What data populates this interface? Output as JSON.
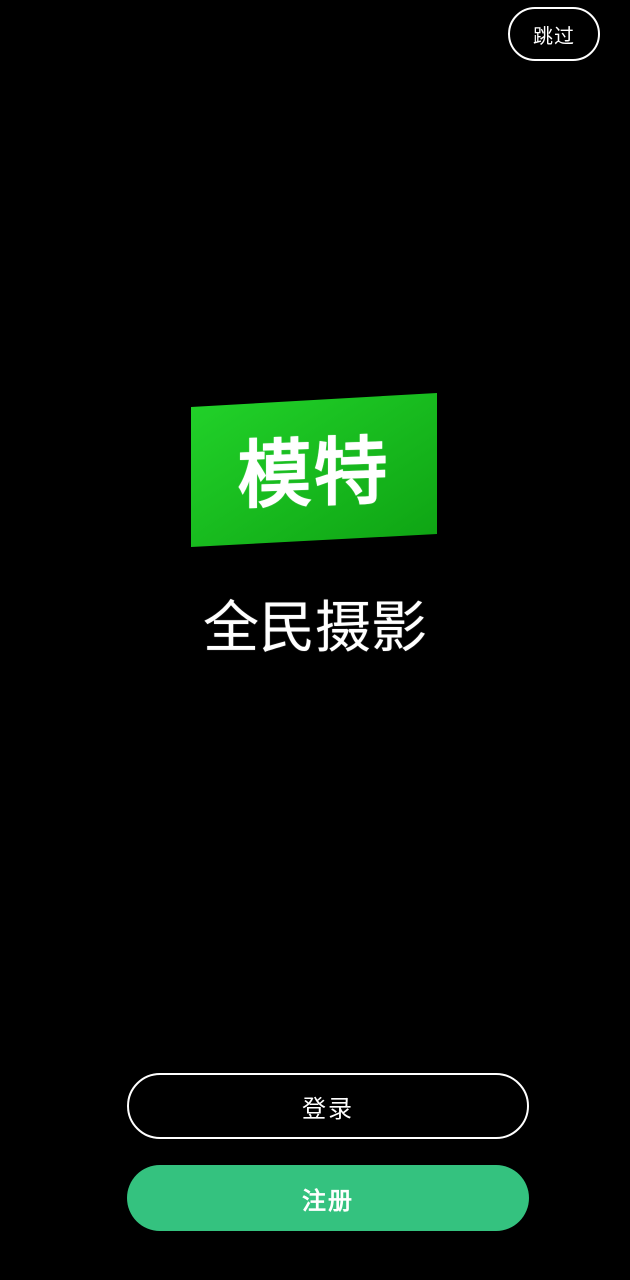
{
  "header": {
    "skip_label": "跳过"
  },
  "logo": {
    "badge_text": "模特",
    "tagline": "全民摄影",
    "badge_color_light": "#22d32a",
    "badge_color_dark": "#10a814"
  },
  "actions": {
    "login_label": "登录",
    "register_label": "注册",
    "register_color": "#34c27f"
  }
}
